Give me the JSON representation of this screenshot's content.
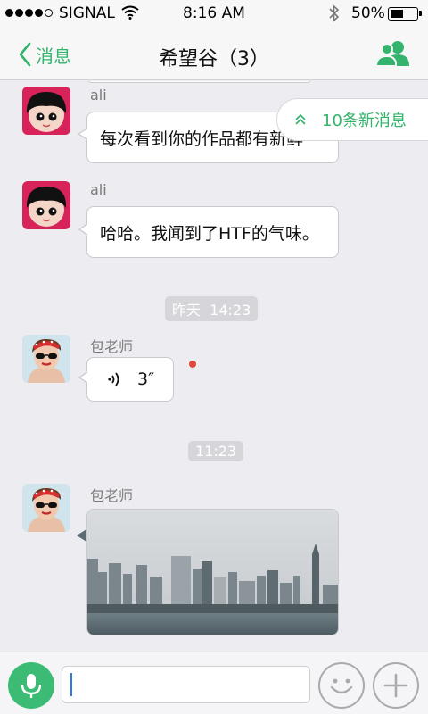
{
  "status_bar": {
    "carrier": "SIGNAL",
    "time": "8:16 AM",
    "battery": "50%",
    "battery_level": 0.5
  },
  "nav": {
    "back_label": "消息",
    "title": "希望谷（3）",
    "members_icon": "group-icon"
  },
  "new_messages_label": "10条新消息",
  "messages": [
    {
      "sender": "ali",
      "text": "每次看到你的作品都有新鲜"
    },
    {
      "sender": "ali",
      "text": "哈哈。我闻到了HTF的气味。"
    },
    {
      "sender": "包老师",
      "voice_duration": "3″"
    },
    {
      "sender": "包老师",
      "image": "city-skyline-photo"
    }
  ],
  "timestamps": [
    "昨天  14:23",
    "11:23"
  ],
  "input": {
    "value": "",
    "mic_icon": "microphone-icon",
    "emoji_icon": "smiley-icon",
    "plus_icon": "plus-icon"
  },
  "colors": {
    "accent": "#33b36b",
    "unread": "#e0463e",
    "background": "#ececf1"
  }
}
